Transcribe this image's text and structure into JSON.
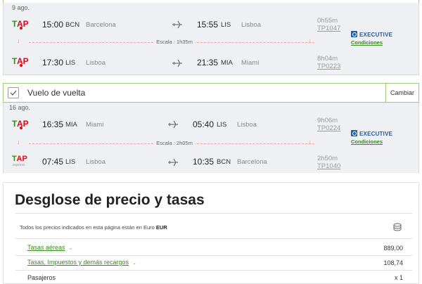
{
  "outbound": {
    "date": "9 ago.",
    "legs": [
      {
        "dep_time": "15:00",
        "dep_code": "BCN",
        "dep_city": "Barcelona",
        "arr_time": "15:55",
        "arr_code": "LIS",
        "arr_city": "Lisboa",
        "duration": "0h55m",
        "flight": "TP1047"
      },
      {
        "dep_time": "17:30",
        "dep_code": "LIS",
        "dep_city": "Lisboa",
        "arr_time": "21:35",
        "arr_code": "MIA",
        "arr_city": "Miami",
        "duration": "8h04m",
        "flight": "TP0223"
      }
    ],
    "layover": "Escala : 1h35m",
    "cabin": "EXECUTIVE",
    "conditions": "Condiciones"
  },
  "return_header": {
    "label": "Vuelo de vuelta",
    "change": "Cambiar"
  },
  "inbound": {
    "date": "16 ago.",
    "legs": [
      {
        "dep_time": "16:35",
        "dep_code": "MIA",
        "dep_city": "Miami",
        "arr_time": "05:40",
        "arr_code": "LIS",
        "arr_city": "Lisboa",
        "duration": "9h06m",
        "flight": "TP0224"
      },
      {
        "dep_time": "07:45",
        "dep_code": "LIS",
        "dep_city": "Lisboa",
        "arr_time": "10:35",
        "arr_code": "BCN",
        "arr_city": "Barcelona",
        "duration": "2h50m",
        "flight": "TP1040"
      }
    ],
    "layover": "Escala : 2h05m",
    "cabin": "EXECUTIVE",
    "conditions": "Condiciones",
    "express_label": "express"
  },
  "price": {
    "title": "Desglose de precio y tasas",
    "note_prefix": "Todos los precios indicados en esta página están en Euro",
    "currency": "EUR",
    "rows": [
      {
        "label": "Tasas aéreas",
        "amount": "889,00"
      },
      {
        "label": "Tasas, Impuestos y demás recargos",
        "amount": "108,74"
      },
      {
        "label": "Pasajeros",
        "amount": "x 1"
      }
    ]
  },
  "colors": {
    "brand_red": "#e30613",
    "brand_green": "#3a8a1e",
    "accent_blue": "#1f5fb0"
  },
  "icons": {
    "logo": "tap-logo",
    "plane": "plane-icon",
    "check": "check-icon",
    "cabin": "executive-icon",
    "coins": "coins-icon"
  }
}
